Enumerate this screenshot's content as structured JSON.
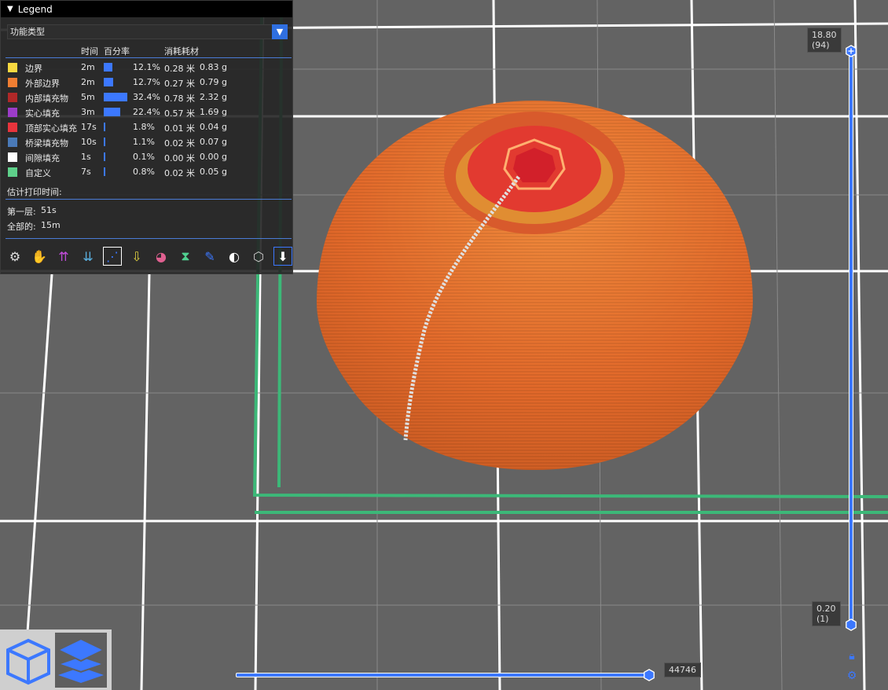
{
  "legend": {
    "title": "Legend",
    "dropdown_value": "功能类型",
    "columns": {
      "time": "时间",
      "percent": "百分率",
      "material": "消耗耗材"
    },
    "rows": [
      {
        "name": "边界",
        "color": "#f8d940",
        "time": "2m",
        "percent_text": "12.1%",
        "percent": 12.1,
        "length": "0.28 米",
        "weight": "0.83 g"
      },
      {
        "name": "外部边界",
        "color": "#f07e32",
        "time": "2m",
        "percent_text": "12.7%",
        "percent": 12.7,
        "length": "0.27 米",
        "weight": "0.79 g"
      },
      {
        "name": "内部填充物",
        "color": "#b02828",
        "time": "5m",
        "percent_text": "32.4%",
        "percent": 32.4,
        "length": "0.78 米",
        "weight": "2.32 g"
      },
      {
        "name": "实心填充",
        "color": "#9c3cc8",
        "time": "3m",
        "percent_text": "22.4%",
        "percent": 22.4,
        "length": "0.57 米",
        "weight": "1.69 g"
      },
      {
        "name": "顶部实心填充",
        "color": "#e8343c",
        "time": "17s",
        "percent_text": "1.8%",
        "percent": 1.8,
        "length": "0.01 米",
        "weight": "0.04 g"
      },
      {
        "name": "桥梁填充物",
        "color": "#4a7ab8",
        "time": "10s",
        "percent_text": "1.1%",
        "percent": 1.1,
        "length": "0.02 米",
        "weight": "0.07 g"
      },
      {
        "name": "间隙填充",
        "color": "#ffffff",
        "time": "1s",
        "percent_text": "0.1%",
        "percent": 0.1,
        "length": "0.00 米",
        "weight": "0.00 g"
      },
      {
        "name": "自定义",
        "color": "#5ed08a",
        "time": "7s",
        "percent_text": "0.8%",
        "percent": 0.8,
        "length": "0.02 米",
        "weight": "0.05 g"
      }
    ],
    "estimate_label": "估计打印时间:",
    "first_layer_label": "第一层:",
    "first_layer_value": "51s",
    "total_label": "全部的:",
    "total_value": "15m"
  },
  "vertical_slider": {
    "top_height": "18.80",
    "top_layer": "(94)",
    "bottom_height": "0.20",
    "bottom_layer": "(1)"
  },
  "horizontal_slider": {
    "value": "44746"
  },
  "colors": {
    "accent": "#3c78ff",
    "model_orange": "#ec6e2c",
    "bed_grid": "#ffffff",
    "bed_border": "#3cb878"
  }
}
